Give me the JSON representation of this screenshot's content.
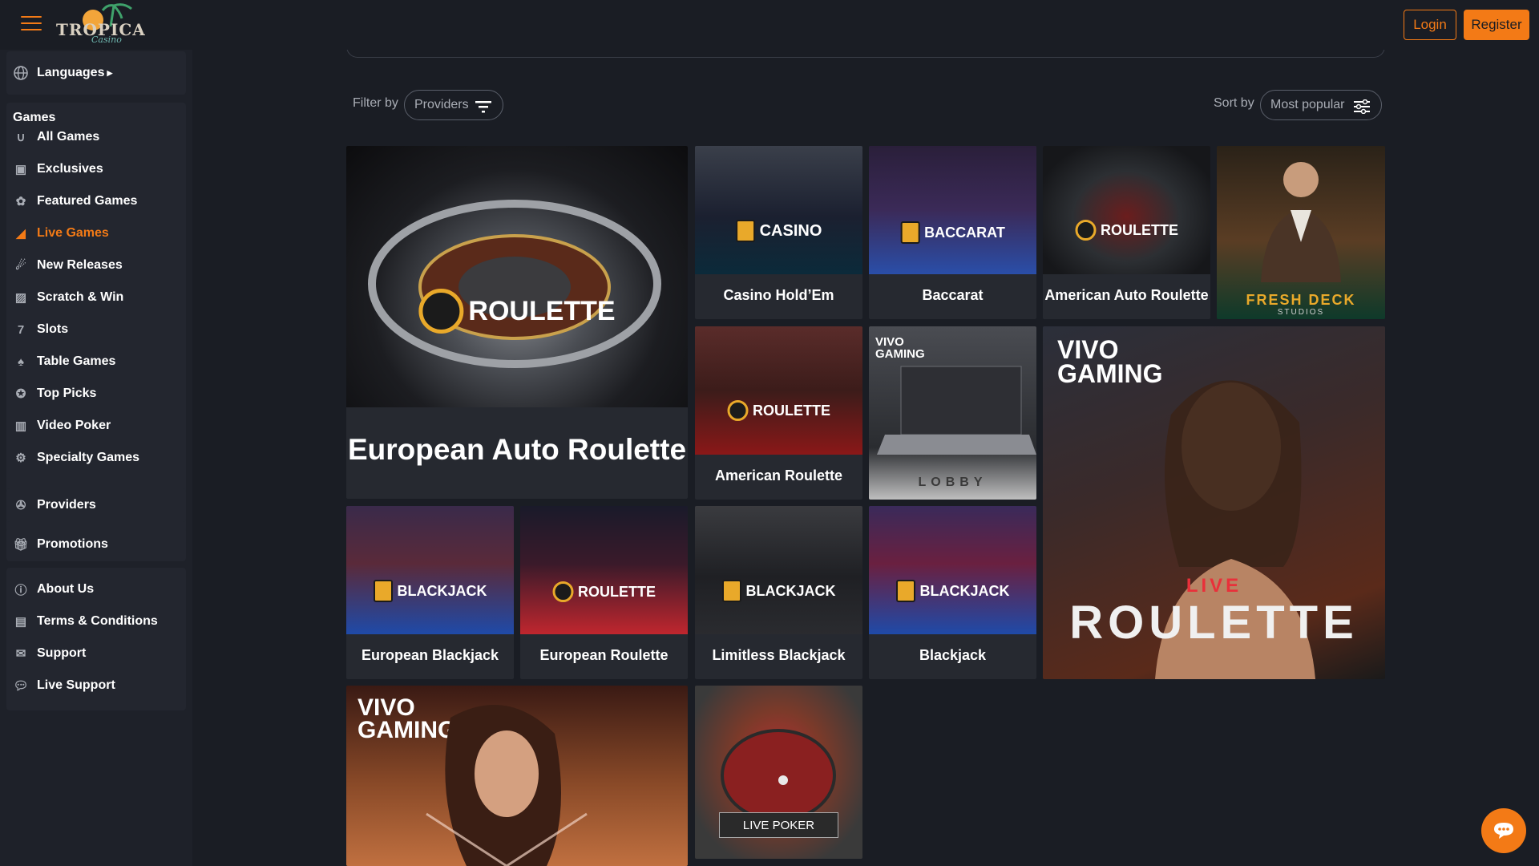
{
  "header": {
    "logo_text": "TROPICA",
    "logo_sub": "Casino",
    "login_label": "Login",
    "register_label": "Register"
  },
  "sidebar": {
    "languages_label": "Languages",
    "games_title": "Games",
    "games": [
      {
        "label": "All Games",
        "icon": "horseshoe-icon"
      },
      {
        "label": "Exclusives",
        "icon": "exclusive-icon"
      },
      {
        "label": "Featured Games",
        "icon": "leaf-icon"
      },
      {
        "label": "Live Games",
        "icon": "live-icon"
      },
      {
        "label": "New Releases",
        "icon": "new-icon"
      },
      {
        "label": "Scratch & Win",
        "icon": "scratch-icon"
      },
      {
        "label": "Slots",
        "icon": "slots-icon"
      },
      {
        "label": "Table Games",
        "icon": "cards-icon"
      },
      {
        "label": "Top Picks",
        "icon": "award-icon"
      },
      {
        "label": "Video Poker",
        "icon": "video-poker-icon"
      },
      {
        "label": "Specialty Games",
        "icon": "gear-icon"
      }
    ],
    "active_item": "Live Games",
    "providers_label": "Providers",
    "promotions_label": "Promotions",
    "info": [
      {
        "label": "About Us",
        "icon": "info-icon"
      },
      {
        "label": "Terms & Conditions",
        "icon": "document-icon"
      },
      {
        "label": "Support",
        "icon": "mail-icon"
      },
      {
        "label": "Live Support",
        "icon": "chat-icon"
      }
    ]
  },
  "filters": {
    "filter_label": "Filter by",
    "providers_pill": "Providers",
    "sort_label": "Sort by",
    "sort_value": "Most popular"
  },
  "games": {
    "european_auto_roulette": {
      "title": "European Auto Roulette",
      "badge": "ROULETTE"
    },
    "casino_holdem": {
      "title": "Casino Hold’Em",
      "badge": "CASINO"
    },
    "baccarat": {
      "title": "Baccarat",
      "badge": "BACCARAT"
    },
    "american_auto_roulette": {
      "title": "American Auto Roulette",
      "badge": "ROULETTE"
    },
    "fresh_deck": {
      "brand": "FRESH DECK",
      "sub": "STUDIOS"
    },
    "american_roulette": {
      "title": "American Roulette",
      "badge": "ROULETTE"
    },
    "vivo_lobby": {
      "brand": "VIVO GAMING",
      "label": "LOBBY"
    },
    "vivo_live_roulette": {
      "brand": "VIVO GAMING",
      "live": "LIVE",
      "label": "ROULETTE"
    },
    "european_blackjack": {
      "title": "European Blackjack",
      "badge": "BLACKJACK"
    },
    "european_roulette": {
      "title": "European Roulette",
      "badge": "ROULETTE"
    },
    "limitless_blackjack": {
      "title": "Limitless Blackjack",
      "badge": "BLACKJACK"
    },
    "blackjack": {
      "title": "Blackjack",
      "badge": "BLACKJACK"
    },
    "vivo_promo": {
      "brand": "VIVO GAMING"
    },
    "live_poker": {
      "label": "LIVE POKER"
    }
  },
  "colors": {
    "accent": "#f37a16",
    "background": "#1a1d24",
    "sidebar": "#1e2129",
    "gold": "#e9a92a"
  }
}
